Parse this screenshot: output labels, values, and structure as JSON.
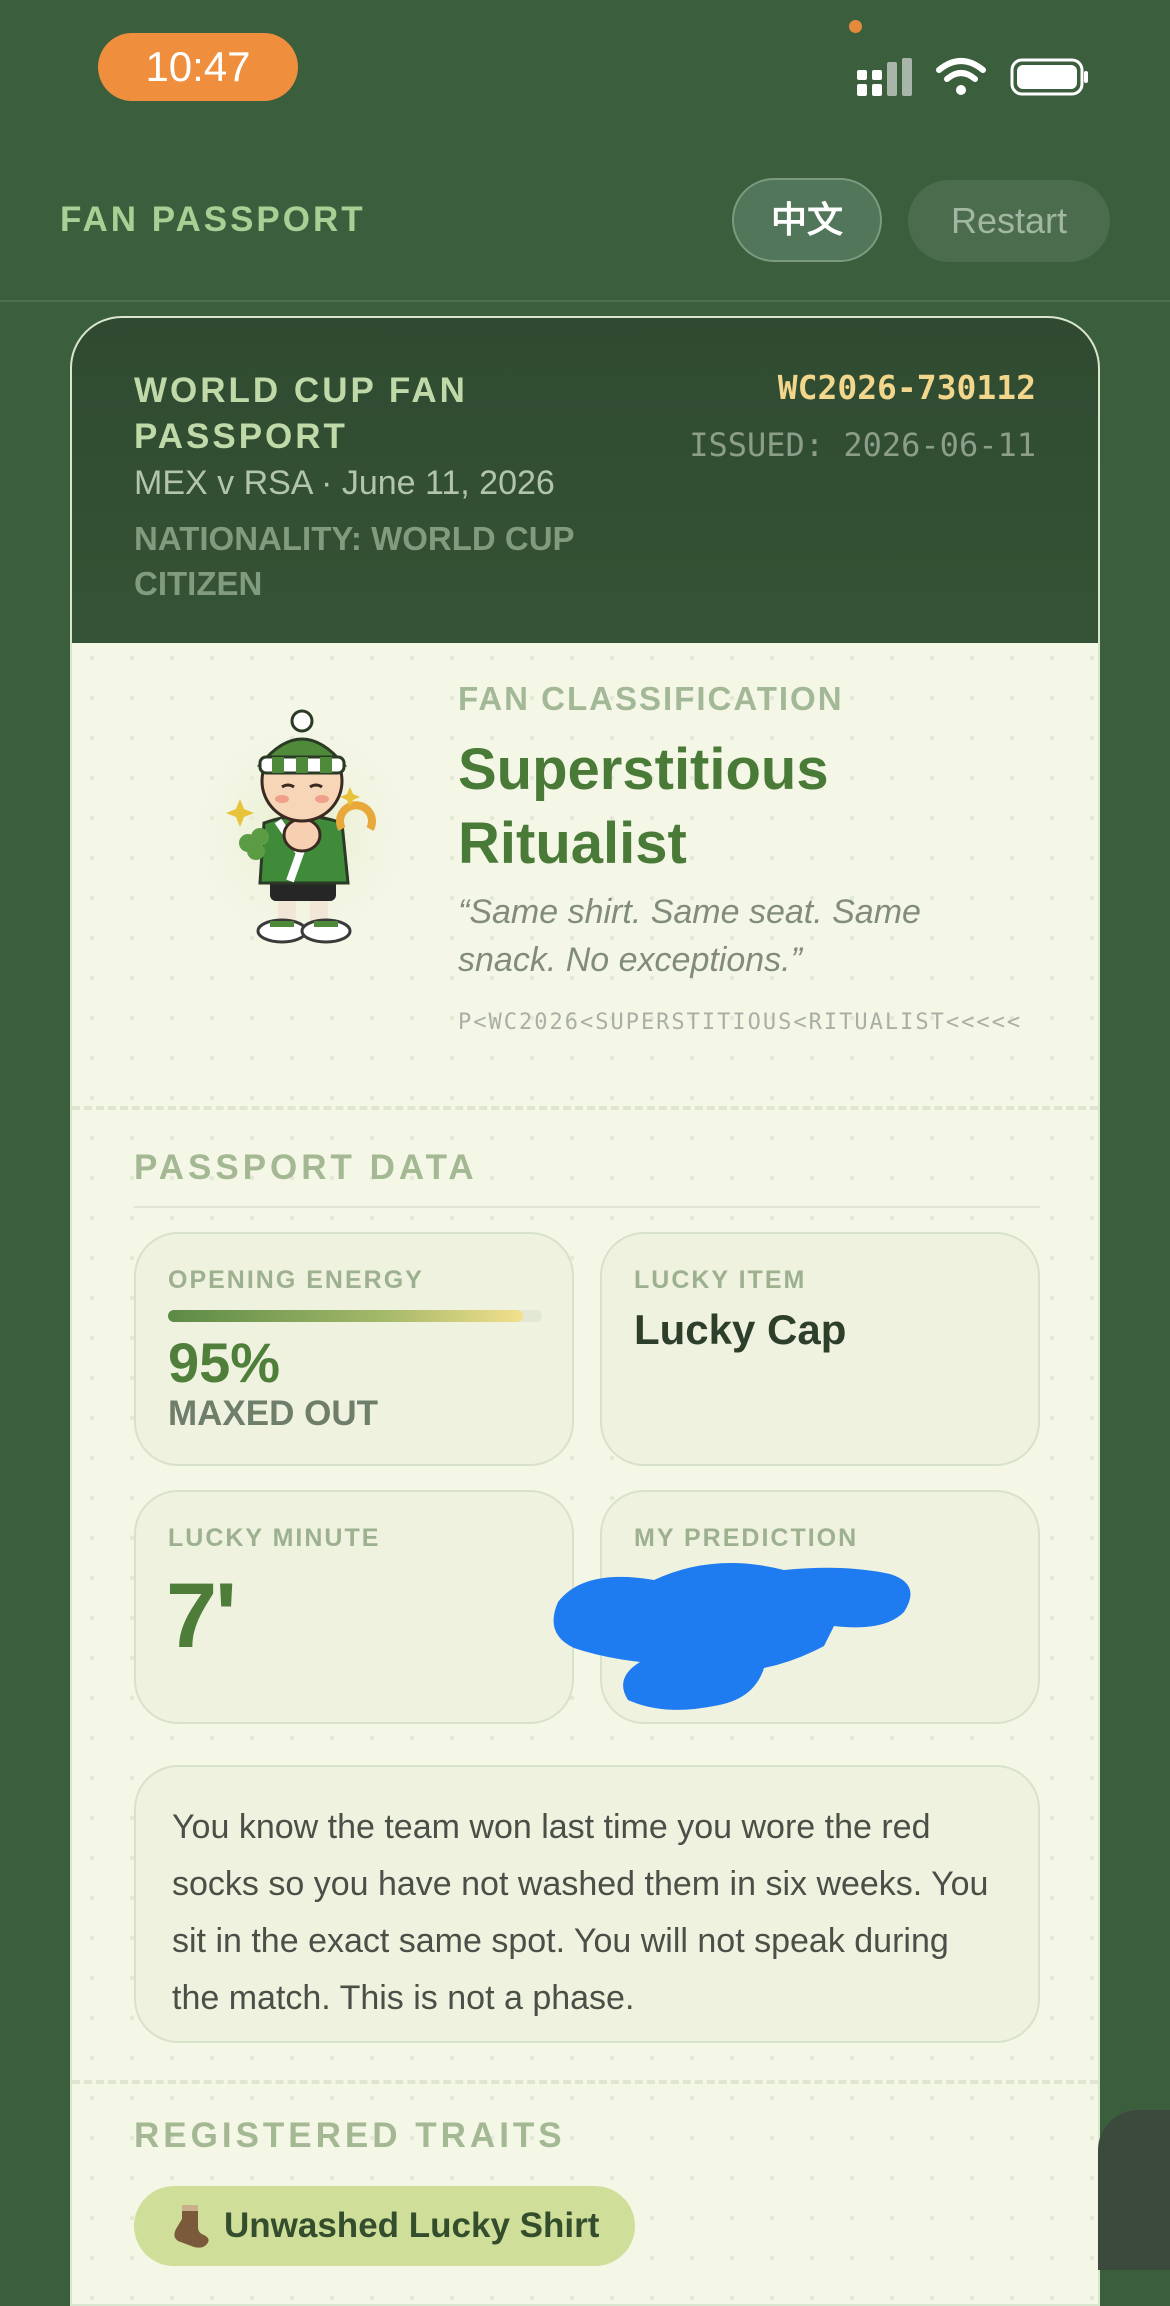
{
  "status_bar": {
    "time": "10:47"
  },
  "header": {
    "brand": "FAN PASSPORT",
    "lang_button": "中文",
    "restart_button": "Restart"
  },
  "passport": {
    "title": "WORLD CUP FAN PASSPORT",
    "match": "MEX v RSA · June 11, 2026",
    "nationality": "NATIONALITY: WORLD CUP CITIZEN",
    "number": "WC2026-730112",
    "issued": "ISSUED: 2026-06-11"
  },
  "profile": {
    "classification_label": "FAN CLASSIFICATION",
    "classification": "Superstitious Ritualist",
    "motto": "“Same shirt. Same seat. Same snack. No exceptions.”",
    "mrz": "P<WC2026<SUPERSTITIOUS<RITUALIST<<<<<"
  },
  "data_section": {
    "title": "PASSPORT DATA",
    "opening_energy": {
      "label": "OPENING ENERGY",
      "percent": 95,
      "value": "95%",
      "status": "MAXED OUT"
    },
    "lucky_item": {
      "label": "LUCKY ITEM",
      "value": "Lucky Cap"
    },
    "lucky_minute": {
      "label": "LUCKY MINUTE",
      "value": "7'"
    },
    "prediction": {
      "label": "MY PREDICTION"
    },
    "description": "You know the team won last time you wore the red socks so you have not washed them in six weeks. You sit in the exact same spot. You will not speak during the match. This is not a phase."
  },
  "traits_section": {
    "title": "REGISTERED TRAITS",
    "traits": [
      {
        "icon": "sock-icon",
        "label": "Unwashed Lucky Shirt"
      }
    ]
  },
  "colors": {
    "background": "#3b5e3d",
    "accent_orange": "#ef8f3e",
    "card": "#f4f6e6",
    "title_green": "#4a7a37"
  }
}
